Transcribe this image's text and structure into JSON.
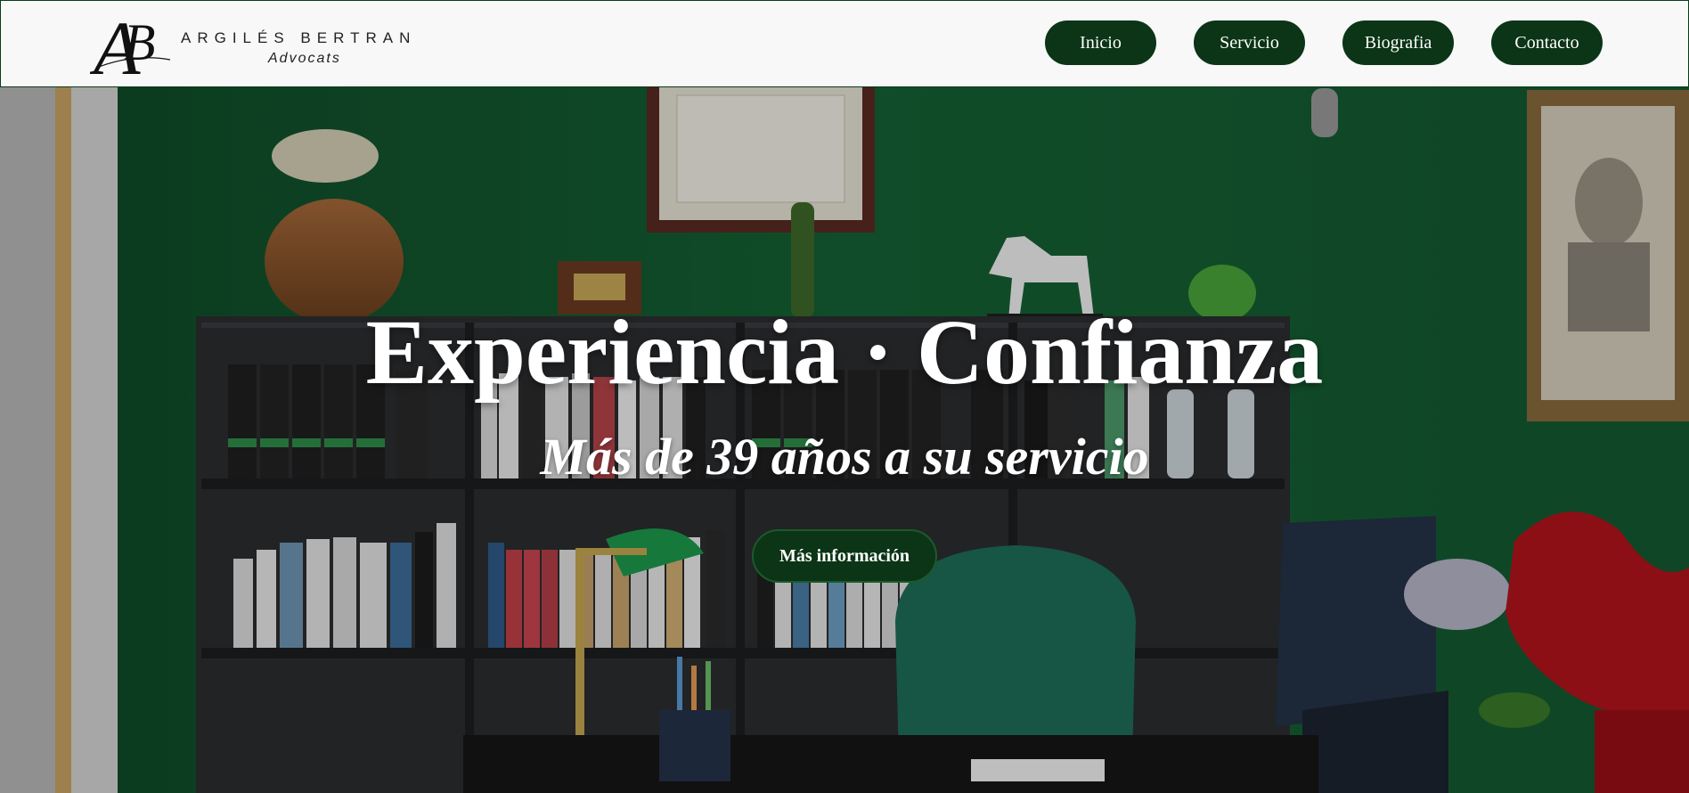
{
  "brand": {
    "mark": "AB",
    "name": "ARGILÉS BERTRAN",
    "subtitle": "Advocats"
  },
  "nav": {
    "items": [
      {
        "label": "Inicio"
      },
      {
        "label": "Servicio"
      },
      {
        "label": "Biografia"
      },
      {
        "label": "Contacto"
      }
    ]
  },
  "hero": {
    "title": "Experiencia · Confianza",
    "subtitle": "Más de 39 años a su servicio",
    "cta_label": "Más información",
    "background": "office-photo"
  },
  "colors": {
    "accent": "#0b3516",
    "header_bg": "#f8f8f8",
    "wall_green": "#155a2f"
  }
}
